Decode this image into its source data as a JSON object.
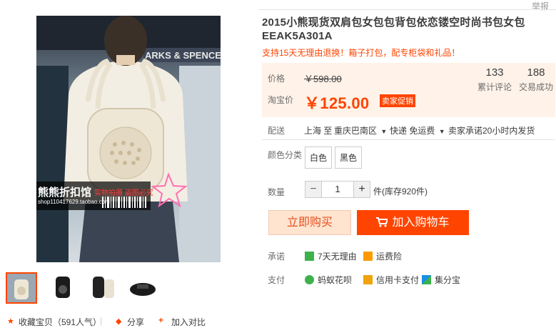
{
  "report_link": "举报",
  "product": {
    "title_line1": "2015小熊现货双肩包女包包背包依恋镂空时尚书包女包",
    "title_line2": "EEAK5A301A",
    "subtitle": "支持15天无理由退换！箱子打包，配专柜袋和礼品！"
  },
  "watermark": {
    "shop_name": "熊熊折扣馆",
    "tag": "实物拍摄 盗图必究",
    "url": "shop110417629.taobao.com"
  },
  "pricing": {
    "price_label": "价格",
    "original_price": "￥598.00",
    "taobao_price_label": "淘宝价",
    "promo_price": "￥125.00",
    "promo_badge": "卖家促销",
    "reviews_count": "133",
    "reviews_label": "累计评论",
    "sales_count": "188",
    "sales_label": "交易成功"
  },
  "shipping": {
    "label": "配送",
    "from": "上海 至",
    "to": "重庆巴南区",
    "express": "快递 免运费",
    "promise": "卖家承诺20小时内发货"
  },
  "color": {
    "label": "颜色分类",
    "options": [
      "白色",
      "黑色"
    ]
  },
  "quantity": {
    "label": "数量",
    "minus": "−",
    "value": "1",
    "plus": "+",
    "stock": "件(库存920件)"
  },
  "actions": {
    "buy_now": "立即购买",
    "add_to_cart": "加入购物车"
  },
  "guarantees": {
    "label": "承诺",
    "items": [
      "7天无理由",
      "运费险"
    ]
  },
  "payment": {
    "label": "支付",
    "items": [
      "蚂蚁花呗",
      "信用卡支付",
      "集分宝"
    ]
  },
  "bottom": {
    "favorite": "收藏宝贝（591人气）",
    "share": "分享",
    "compare": "加入对比"
  },
  "colors": {
    "accent": "#ff4400",
    "price_bg": "#fff2e8"
  }
}
